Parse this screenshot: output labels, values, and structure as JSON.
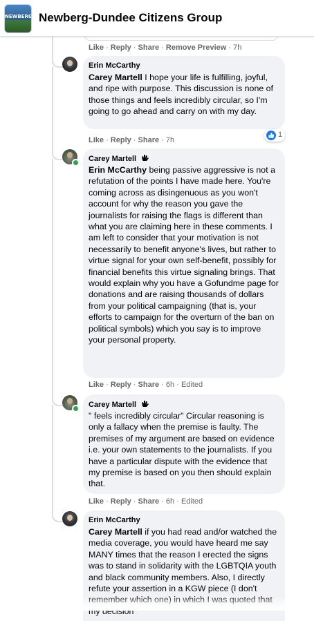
{
  "header": {
    "group_name": "Newberg-Dundee Citizens Group",
    "logo_text": "NEWBERG"
  },
  "top_actions": {
    "like": "Like",
    "reply": "Reply",
    "share": "Share",
    "remove_preview": "Remove Preview",
    "time": "7h"
  },
  "comments": [
    {
      "author": "Erin McCarthy",
      "mention": "Carey Martell",
      "text": " I hope your life is fulfilling, joyful, and ripe with purpose. This discussion is none of those things and feels incredibly circular, so I'm going to go ahead and carry on with my day.",
      "reaction_count": "1",
      "actions": {
        "like": "Like",
        "reply": "Reply",
        "share": "Share",
        "time": "7h",
        "edited": ""
      }
    },
    {
      "author": "Carey Martell",
      "mention": "Erin McCarthy",
      "text": " being passive aggressive is not a refutation of the points I have made here. You're coming across as disingenuous as you won't account for why the reason you gave the journalists for raising the flags is different than what you are claiming here in these comments. I am left to consider that your motivation is not necessarily to benefit anyone's lives, but rather to virtue signal for your own self-benefit, possibly for financial benefits this virtue signaling brings. That would explain why you have a Gofundme page for donations and are raising thousands of dollars from your political campaigning (that is, your efforts to campaign for the overturn of the ban on political symbols) which you say is to improve your personal property.",
      "actions": {
        "like": "Like",
        "reply": "Reply",
        "share": "Share",
        "time": "6h",
        "edited": "Edited"
      }
    },
    {
      "author": "Carey Martell",
      "mention": "",
      "text": "\" feels incredibly circular\" Circular reasoning is only a fallacy when the premise is faulty. The premises of my argument are based on evidence i.e. your own statements to the journalists. If you have a particular dispute with the evidence that my premise is based on you then should explain that.",
      "actions": {
        "like": "Like",
        "reply": "Reply",
        "share": "Share",
        "time": "6h",
        "edited": "Edited"
      }
    },
    {
      "author": "Erin McCarthy",
      "mention": "Carey Martell",
      "text": " if you had read and/or watched the media coverage, you would have heard me say MANY times that the reason I erected the signs was to stand in solidarity with the LGBTQIA youth and black community members. Also, I directly refute your assertion in a KGW piece (I don't remember which one) in which I was quoted that my decision"
    }
  ],
  "colors": {
    "bubble": "#f0f2f5",
    "meta_text": "#65676b",
    "like_blue": "#1877f2",
    "online_green": "#31a24c"
  }
}
